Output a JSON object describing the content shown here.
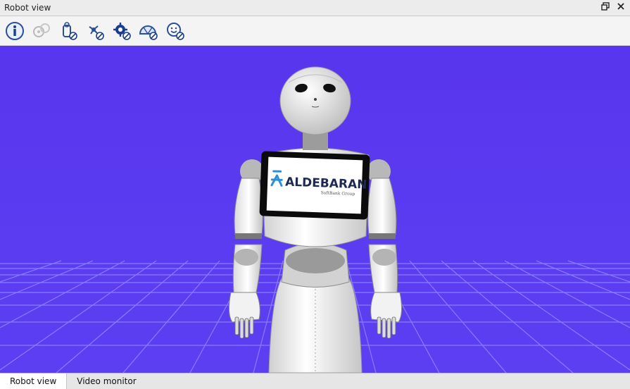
{
  "window": {
    "title": "Robot view"
  },
  "titlebar_buttons": [
    {
      "name": "restore-icon",
      "glyph": "🗗"
    },
    {
      "name": "close-icon",
      "glyph": "✕"
    }
  ],
  "toolbar": {
    "icons": [
      "info-icon",
      "joints-icon",
      "collision-icon",
      "sensors-icon",
      "settings-icon",
      "field-of-view-icon",
      "face-icon"
    ]
  },
  "viewport": {
    "background": "#5a38f0",
    "tablet": {
      "brand": "ALDEBARAN",
      "subbrand": "SoftBank Group"
    }
  },
  "tabs": [
    {
      "label": "Robot view",
      "active": true
    },
    {
      "label": "Video monitor",
      "active": false
    }
  ]
}
